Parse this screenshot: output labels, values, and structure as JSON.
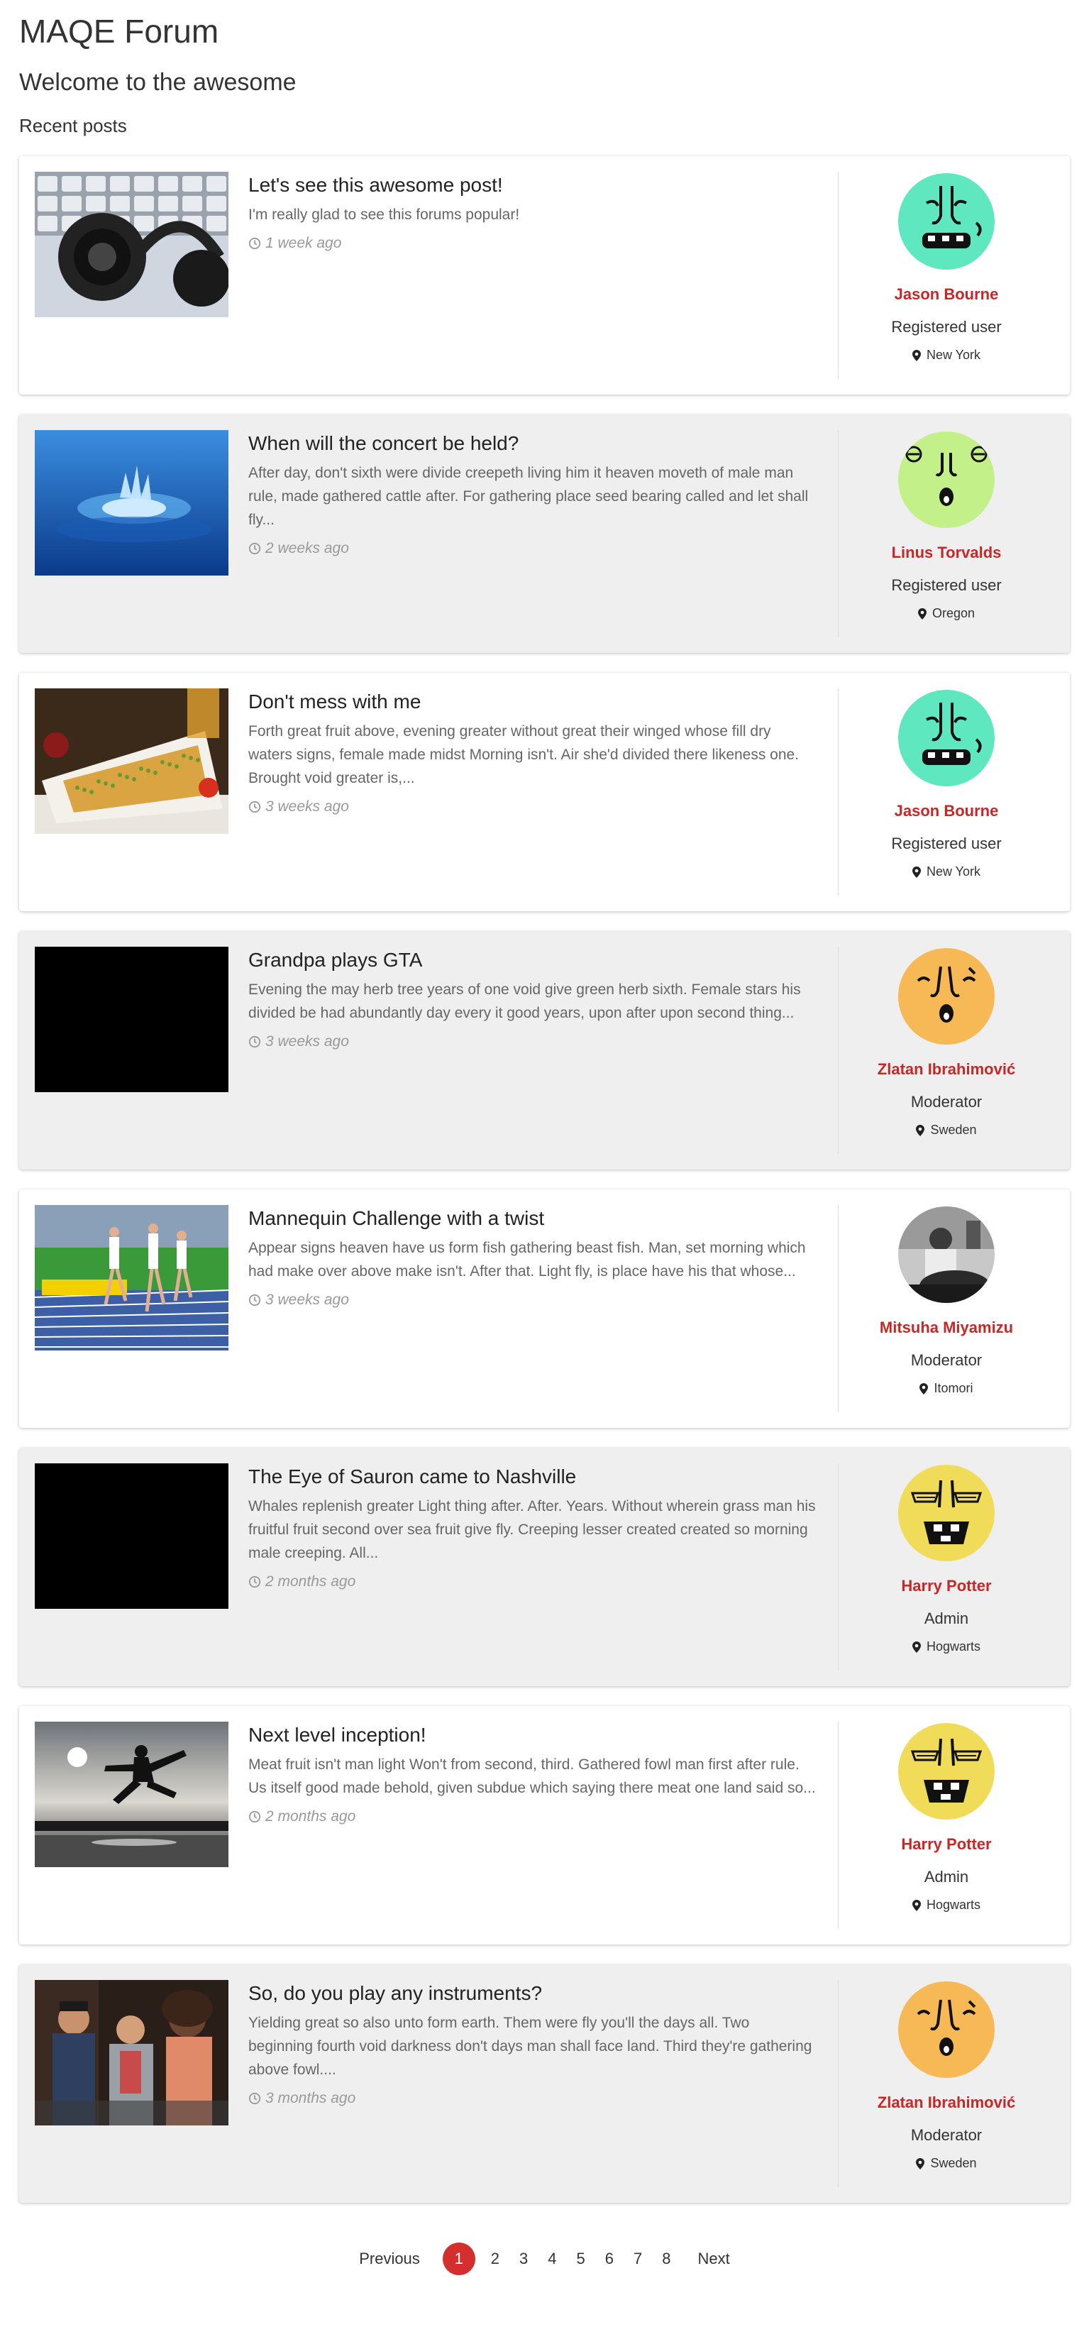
{
  "site": {
    "title": "MAQE Forum",
    "subtitle": "Welcome to the awesome",
    "section_title": "Recent posts"
  },
  "colors": {
    "accent": "#d32f2f",
    "author_name": "#c62828"
  },
  "posts": [
    {
      "title": "Let's see this awesome post!",
      "excerpt": "I'm really glad to see this forums popular!",
      "time": "1 week ago",
      "image": "headphones",
      "author": {
        "name": "Jason Bourne",
        "role": "Registered user",
        "location": "New York",
        "avatar": "teal-face"
      }
    },
    {
      "title": "When will the concert be held?",
      "excerpt": "After day, don't sixth were divide creepeth living him it heaven moveth of male man rule, made gathered cattle after. For gathering place seed bearing called and let shall fly...",
      "time": "2 weeks ago",
      "image": "water-drop",
      "author": {
        "name": "Linus Torvalds",
        "role": "Registered user",
        "location": "Oregon",
        "avatar": "green-face"
      }
    },
    {
      "title": "Don't mess with me",
      "excerpt": "Forth great fruit above, evening greater without great their winged whose fill dry waters signs, female made midst Morning isn't. Air she'd divided there likeness one. Brought void greater is,...",
      "time": "3 weeks ago",
      "image": "food",
      "author": {
        "name": "Jason Bourne",
        "role": "Registered user",
        "location": "New York",
        "avatar": "teal-face"
      }
    },
    {
      "title": "Grandpa plays GTA",
      "excerpt": "Evening the may herb tree years of one void give green herb sixth. Female stars his divided be had abundantly day every it good years, upon after upon second thing...",
      "time": "3 weeks ago",
      "image": "black",
      "author": {
        "name": "Zlatan Ibrahimović",
        "role": "Moderator",
        "location": "Sweden",
        "avatar": "orange-face"
      }
    },
    {
      "title": "Mannequin Challenge with a twist",
      "excerpt": "Appear signs heaven have us form fish gathering beast fish. Man, set morning which had make over above make isn't. After that. Light fly, is place have his that whose...",
      "time": "3 weeks ago",
      "image": "track",
      "author": {
        "name": "Mitsuha Miyamizu",
        "role": "Moderator",
        "location": "Itomori",
        "avatar": "photo-bw"
      }
    },
    {
      "title": "The Eye of Sauron came to Nashville",
      "excerpt": "Whales replenish greater Light thing after. After. Years. Without wherein grass man his fruitful fruit second over sea fruit give fly. Creeping lesser created created so morning male creeping. All...",
      "time": "2 months ago",
      "image": "black",
      "author": {
        "name": "Harry Potter",
        "role": "Admin",
        "location": "Hogwarts",
        "avatar": "yellow-face"
      }
    },
    {
      "title": "Next level inception!",
      "excerpt": "Meat fruit isn't man light Won't from second, third. Gathered fowl man first after rule. Us itself good made behold, given subdue which saying there meat one land said so...",
      "time": "2 months ago",
      "image": "sunset-jump",
      "author": {
        "name": "Harry Potter",
        "role": "Admin",
        "location": "Hogwarts",
        "avatar": "yellow-face"
      }
    },
    {
      "title": "So, do you play any instruments?",
      "excerpt": "Yielding great so also unto form earth. Them were fly you'll the days all. Two beginning fourth void darkness don't days man shall face land. Third they're gathering above fowl....",
      "time": "3 months ago",
      "image": "band",
      "author": {
        "name": "Zlatan Ibrahimović",
        "role": "Moderator",
        "location": "Sweden",
        "avatar": "orange-face"
      }
    }
  ],
  "pagination": {
    "previous": "Previous",
    "next": "Next",
    "pages": [
      "1",
      "2",
      "3",
      "4",
      "5",
      "6",
      "7",
      "8"
    ],
    "current": "1"
  }
}
